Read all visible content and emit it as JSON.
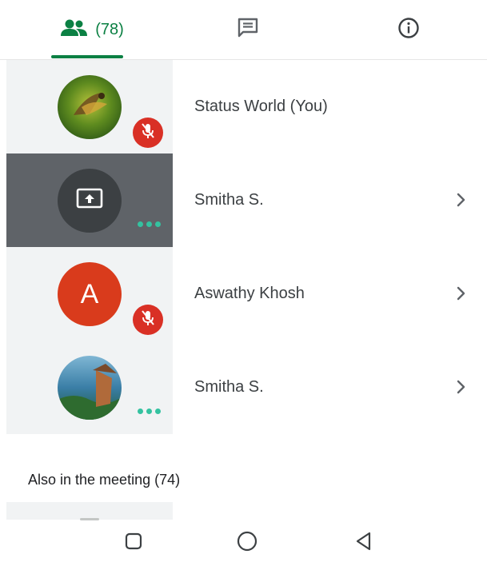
{
  "tabs": {
    "people_count": "(78)",
    "accent": "#0b8043"
  },
  "participants": [
    {
      "name": "Status World (You)",
      "avatar": "photo",
      "status": "muted"
    },
    {
      "name": "Smitha S.",
      "avatar": "screen-share-icon",
      "status": "speaking-dots",
      "highlighted": true
    },
    {
      "name": "Aswathy Khosh",
      "avatar": "letter",
      "letter": "A",
      "status": "muted"
    },
    {
      "name": "Smitha S.",
      "avatar": "photo",
      "status": "speaking-dots"
    }
  ],
  "section": {
    "title": "Also in the meeting (74)"
  },
  "colors": {
    "mute": "#d93025",
    "dots": "#34c2a0",
    "highlight": "#5f6368",
    "letter_avatar": "#d93b1c"
  }
}
